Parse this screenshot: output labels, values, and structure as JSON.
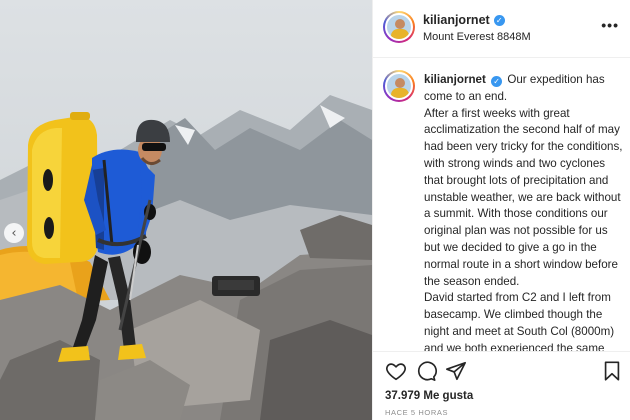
{
  "post": {
    "username": "kilianjornet",
    "location": "Mount Everest 8848M",
    "more_label": "•••",
    "verified_glyph": "✓",
    "caption_body": "Our expedition has come to an end.\nAfter a first weeks with great acclimatization the second half of may had been very tricky for the conditions, with strong winds and two cyclones that brought lots of precipitation and unstable weather, we are back without a summit. With those conditions our original plan was not possible for us but we decided to give a go in the normal route in a short window before the season ended.\nDavid started from C2 and I left from basecamp. We climbed though the night and meet at South Col (8000m) and we both experienced the same sensation of not feeling well or strong. It was a bizarre moment when we regrouped at South Col and told each",
    "likes": "37.979 Me gusta",
    "time": "HACE 5 HORAS",
    "prev_glyph": "‹"
  },
  "icons": {
    "like": "heart-icon",
    "comment": "comment-icon",
    "share": "share-icon",
    "save": "bookmark-icon",
    "prev": "chevron-left-icon"
  },
  "colors": {
    "verified": "#3897f0",
    "jacket": "#1e5bd6",
    "pack": "#f2c21b"
  }
}
